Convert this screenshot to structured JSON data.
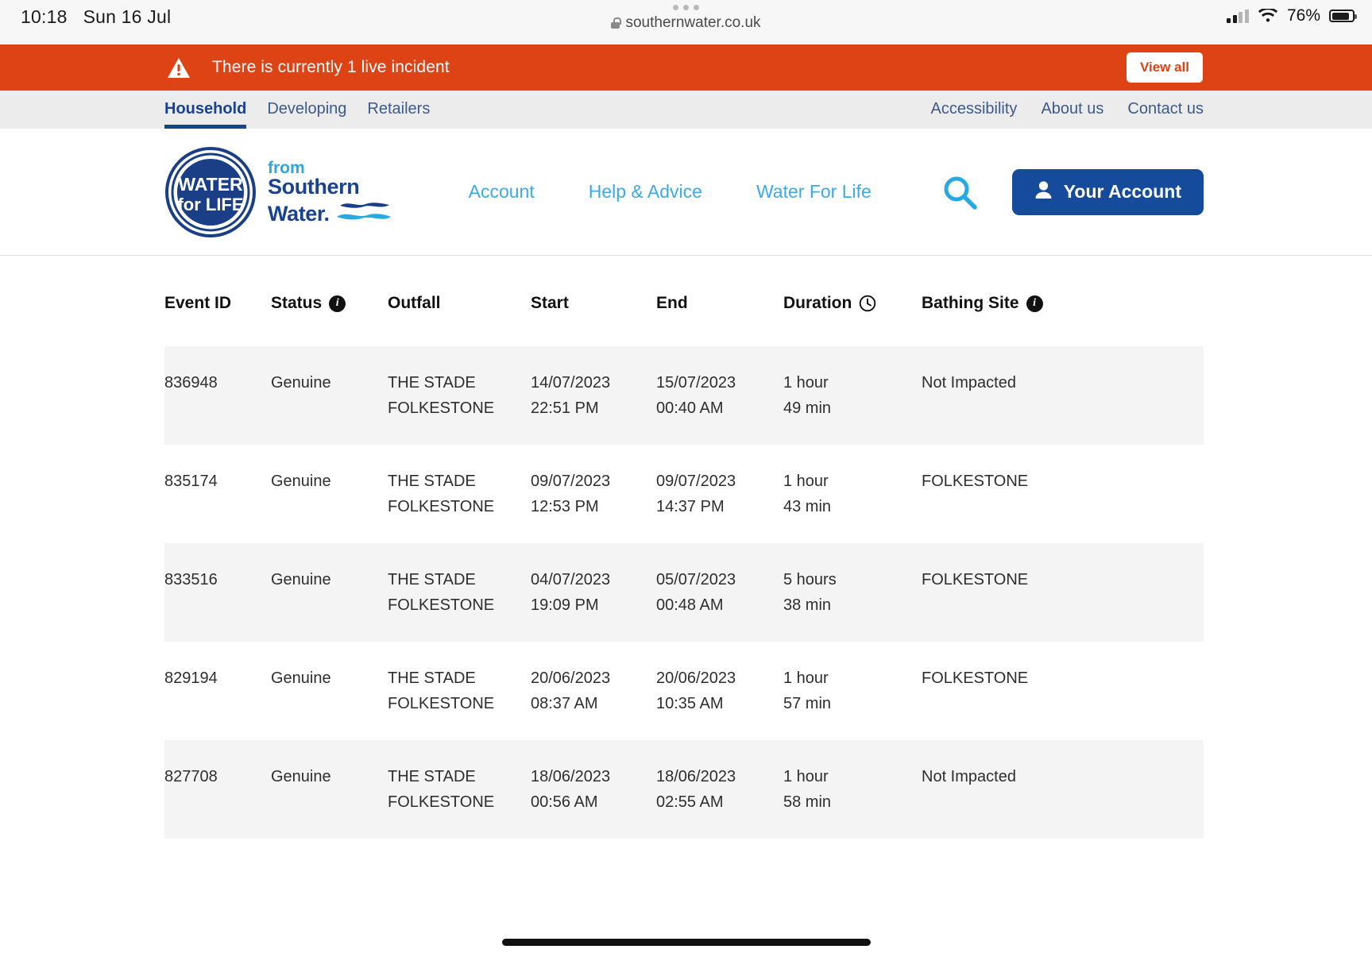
{
  "status_bar": {
    "time": "10:18",
    "date": "Sun 16 Jul",
    "battery_percent": "76%",
    "signal_icon": "cellular-signal-icon",
    "wifi_icon": "wifi-icon",
    "battery_icon": "battery-icon"
  },
  "browser": {
    "url": "southernwater.co.uk",
    "lock_icon": "lock-icon",
    "tabs_icon": "more-dots-icon"
  },
  "alert": {
    "icon": "warning-triangle-icon",
    "message": "There is currently 1 live incident",
    "button_label": "View all",
    "background_color": "#dd4314"
  },
  "subnav": {
    "left_items": [
      {
        "label": "Household",
        "active": true
      },
      {
        "label": "Developing",
        "active": false
      },
      {
        "label": "Retailers",
        "active": false
      }
    ],
    "right_items": [
      {
        "label": "Accessibility"
      },
      {
        "label": "About us"
      },
      {
        "label": "Contact us"
      }
    ],
    "active_color": "#19428f"
  },
  "header": {
    "logo": {
      "seal_line1": "WATER",
      "seal_line2": "for LIFE",
      "from": "from",
      "brand_line1": "Southern",
      "brand_line2": "Water.",
      "wave_icon": "wave-icon"
    },
    "nav": [
      {
        "label": "Account"
      },
      {
        "label": "Help & Advice"
      },
      {
        "label": "Water For Life"
      }
    ],
    "search_icon": "search-icon",
    "account_button": {
      "label": "Your Account",
      "icon": "person-icon",
      "color": "#164a9a"
    }
  },
  "table": {
    "columns": [
      {
        "label": "Event ID",
        "icon": null
      },
      {
        "label": "Status",
        "icon": "info-icon"
      },
      {
        "label": "Outfall",
        "icon": null
      },
      {
        "label": "Start",
        "icon": null
      },
      {
        "label": "End",
        "icon": null
      },
      {
        "label": "Duration",
        "icon": "clock-icon"
      },
      {
        "label": "Bathing Site",
        "icon": "info-icon"
      }
    ],
    "rows": [
      {
        "event_id": "836948",
        "status": "Genuine",
        "outfall_line1": "THE STADE",
        "outfall_line2": "FOLKESTONE",
        "start_date": "14/07/2023",
        "start_time": "22:51 PM",
        "end_date": "15/07/2023",
        "end_time": "00:40 AM",
        "duration_line1": "1 hour",
        "duration_line2": "49 min",
        "bathing_site": "Not Impacted"
      },
      {
        "event_id": "835174",
        "status": "Genuine",
        "outfall_line1": "THE STADE",
        "outfall_line2": "FOLKESTONE",
        "start_date": "09/07/2023",
        "start_time": "12:53 PM",
        "end_date": "09/07/2023",
        "end_time": "14:37 PM",
        "duration_line1": "1 hour",
        "duration_line2": "43 min",
        "bathing_site": "FOLKESTONE"
      },
      {
        "event_id": "833516",
        "status": "Genuine",
        "outfall_line1": "THE STADE",
        "outfall_line2": "FOLKESTONE",
        "start_date": "04/07/2023",
        "start_time": "19:09 PM",
        "end_date": "05/07/2023",
        "end_time": "00:48 AM",
        "duration_line1": "5 hours",
        "duration_line2": "38 min",
        "bathing_site": "FOLKESTONE"
      },
      {
        "event_id": "829194",
        "status": "Genuine",
        "outfall_line1": "THE STADE",
        "outfall_line2": "FOLKESTONE",
        "start_date": "20/06/2023",
        "start_time": "08:37 AM",
        "end_date": "20/06/2023",
        "end_time": "10:35 AM",
        "duration_line1": "1 hour",
        "duration_line2": "57 min",
        "bathing_site": "FOLKESTONE"
      },
      {
        "event_id": "827708",
        "status": "Genuine",
        "outfall_line1": "THE STADE",
        "outfall_line2": "FOLKESTONE",
        "start_date": "18/06/2023",
        "start_time": "00:56 AM",
        "end_date": "18/06/2023",
        "end_time": "02:55 AM",
        "duration_line1": "1 hour",
        "duration_line2": "58 min",
        "bathing_site": "Not Impacted"
      }
    ]
  }
}
